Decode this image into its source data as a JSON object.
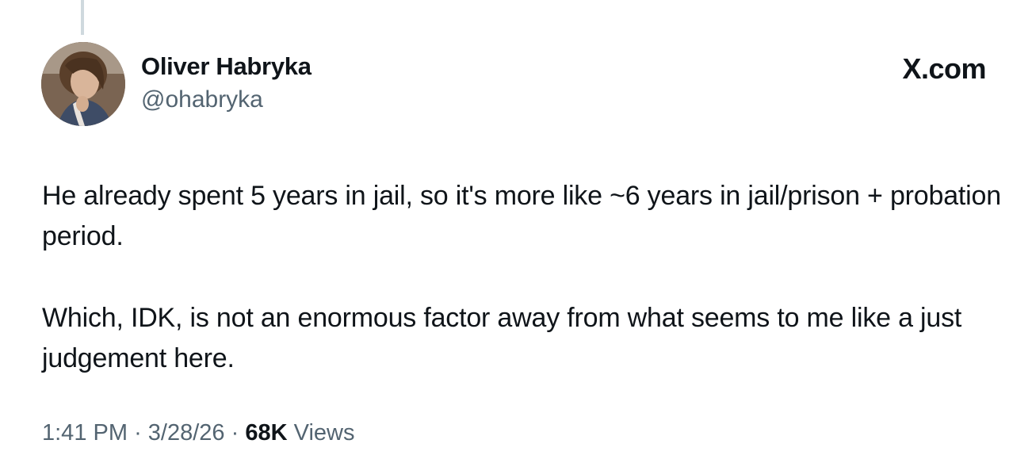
{
  "author": {
    "name": "Oliver Habryka",
    "handle": "@ohabryka"
  },
  "brand": "X.com",
  "tweet": {
    "paragraphs": [
      "He already spent 5 years in jail, so it's more like ~6 years in jail/prison + probation period.",
      "Which, IDK, is not an enormous factor away from what seems to me like a just judgement here."
    ]
  },
  "meta": {
    "time": "1:41 PM",
    "separator": "·",
    "date": "3/28/26",
    "views_count": "68K",
    "views_label": "Views"
  }
}
